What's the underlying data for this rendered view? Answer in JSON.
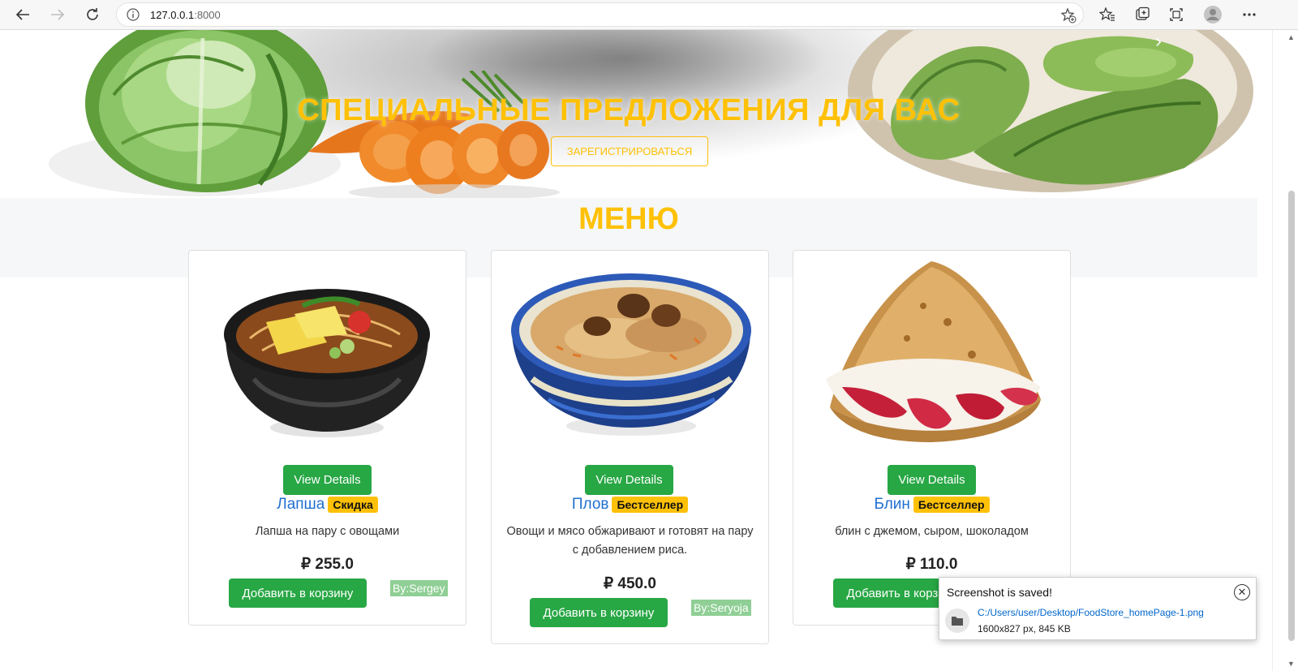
{
  "browser": {
    "url_host": "127.0.0.1",
    "url_port": ":8000"
  },
  "hero": {
    "title": "СПЕЦИАЛЬНЫЕ ПРЕДЛОЖЕНИЯ ДЛЯ ВАС",
    "button": "ЗАРЕГИСТРИРОВАТЬСЯ",
    "prev": "‹",
    "next": "›"
  },
  "menu": {
    "title": "МЕНЮ",
    "items": [
      {
        "details_label": "View Details",
        "name": "Лапша",
        "badge": "Скидка",
        "description": "Лапша на пару с овощами",
        "price": "₽ 255.0",
        "cart_label": "Добавить в корзину",
        "author": "By:Sergey"
      },
      {
        "details_label": "View Details",
        "name": "Плов",
        "badge": "Бестселлер",
        "description": "Овощи и мясо обжаривают и готовят на пару с добавлением риса.",
        "price": "₽ 450.0",
        "cart_label": "Добавить в корзину",
        "author": "By:Seryoja"
      },
      {
        "details_label": "View Details",
        "name": "Блин",
        "badge": "Бестселлер",
        "description": "блин с джемом, сыром, шоколадом",
        "price": "₽ 110.0",
        "cart_label": "Добавить в корзину",
        "author": ""
      }
    ]
  },
  "toast": {
    "title": "Screenshot is saved!",
    "path": "C:/Users/user/Desktop/FoodStore_homePage-1.png",
    "meta": "1600x827 px, 845 KB"
  },
  "colors": {
    "accent": "#ffc107",
    "button": "#28a745",
    "link": "#1f6fd0"
  }
}
